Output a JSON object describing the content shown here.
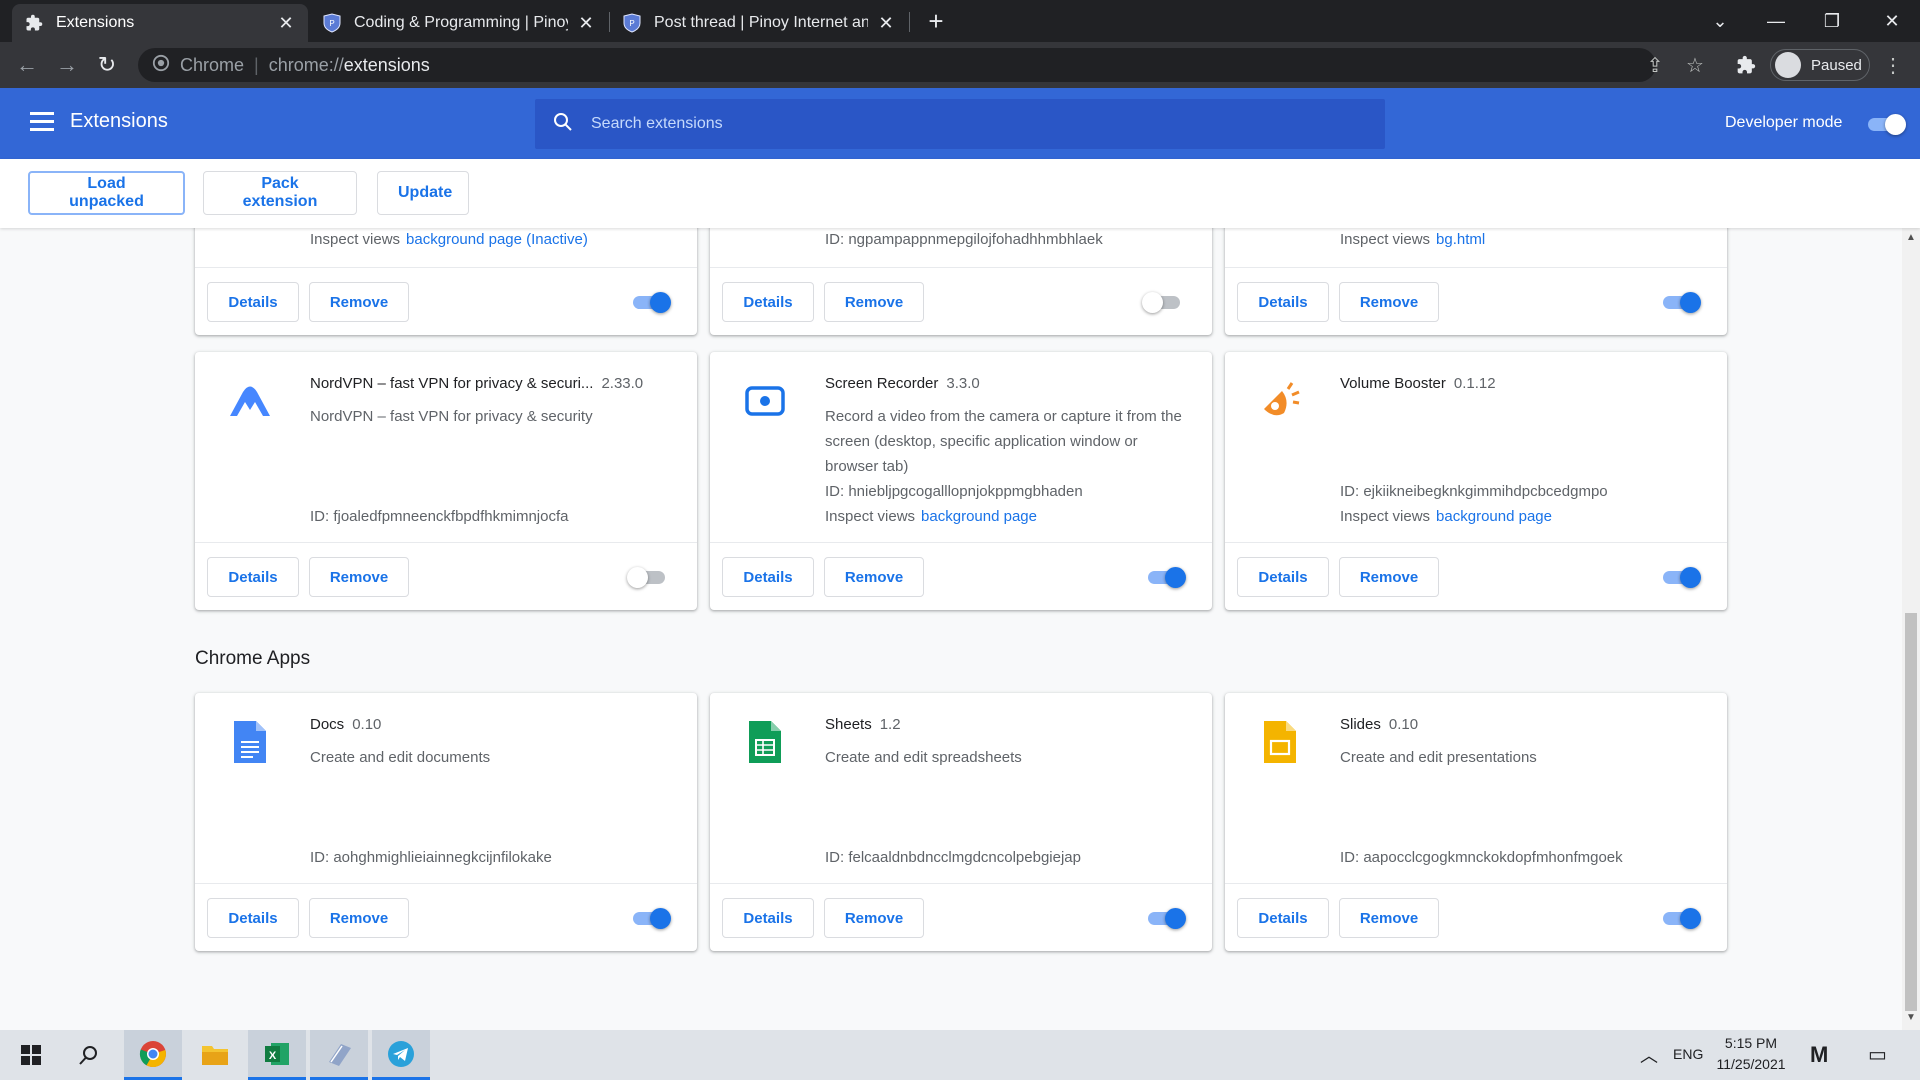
{
  "tabs": [
    {
      "title": "Extensions",
      "icon": "puzzle-icon"
    },
    {
      "title": "Coding & Programming | Pinoy I",
      "icon": "forum-icon"
    },
    {
      "title": "Post thread | Pinoy Internet and",
      "icon": "forum-icon"
    }
  ],
  "omnibox": {
    "chip": "Chrome",
    "separator": "|",
    "scheme": "chrome://",
    "path": "extensions"
  },
  "profile": {
    "status": "Paused"
  },
  "header": {
    "title": "Extensions",
    "search_placeholder": "Search extensions",
    "developer_mode_label": "Developer mode",
    "developer_mode_on": true
  },
  "actions": {
    "load_unpacked": "Load unpacked",
    "pack_extension": "Pack extension",
    "update": "Update"
  },
  "common": {
    "details": "Details",
    "remove": "Remove",
    "inspect_views": "Inspect views"
  },
  "top_row": [
    {
      "inspect_link": "background page (Inactive)",
      "enabled": true
    },
    {
      "id_text": "ID: ngpampappnmepgilojfohadhhmbhlaek",
      "enabled": false
    },
    {
      "inspect_link": "bg.html",
      "enabled": true
    }
  ],
  "extensions": [
    {
      "name": "NordVPN – fast VPN for privacy & securi...",
      "version": "2.33.0",
      "description": "NordVPN – fast VPN for privacy & security",
      "id_text": "ID: fjoaledfpmneenckfbpdfhkmimnjocfa",
      "inspect_link": "",
      "enabled": false,
      "icon": "nordvpn-icon"
    },
    {
      "name": "Screen Recorder",
      "version": "3.3.0",
      "description": "Record a video from the camera or capture it from the screen (desktop, specific application window or browser tab)",
      "id_text": "ID: hniebljpgcogalllopnjokppmgbhaden",
      "inspect_link": "background page",
      "enabled": true,
      "icon": "screen-recorder-icon"
    },
    {
      "name": "Volume Booster",
      "version": "0.1.12",
      "description": "",
      "id_text": "ID: ejkiikneibegknkgimmihdpcbcedgmpo",
      "inspect_link": "background page",
      "enabled": true,
      "icon": "volume-booster-icon"
    }
  ],
  "chrome_apps_title": "Chrome Apps",
  "apps": [
    {
      "name": "Docs",
      "version": "0.10",
      "description": "Create and edit documents",
      "id_text": "ID: aohghmighlieiainnegkcijnfilokake",
      "enabled": true,
      "icon": "docs-icon",
      "color": "#4285f4"
    },
    {
      "name": "Sheets",
      "version": "1.2",
      "description": "Create and edit spreadsheets",
      "id_text": "ID: felcaaldnbdncclmgdcncolpebgiejap",
      "enabled": true,
      "icon": "sheets-icon",
      "color": "#0f9d58"
    },
    {
      "name": "Slides",
      "version": "0.10",
      "description": "Create and edit presentations",
      "id_text": "ID: aapocclcgogkmnckokdopfmhonfmgoek",
      "enabled": true,
      "icon": "slides-icon",
      "color": "#f4b400"
    }
  ],
  "taskbar": {
    "language": "ENG",
    "time": "5:15 PM",
    "date": "11/25/2021"
  },
  "colors": {
    "header": "#3367d6",
    "accent": "#1a73e8",
    "toggle_track_on": "#8ab4f8"
  }
}
